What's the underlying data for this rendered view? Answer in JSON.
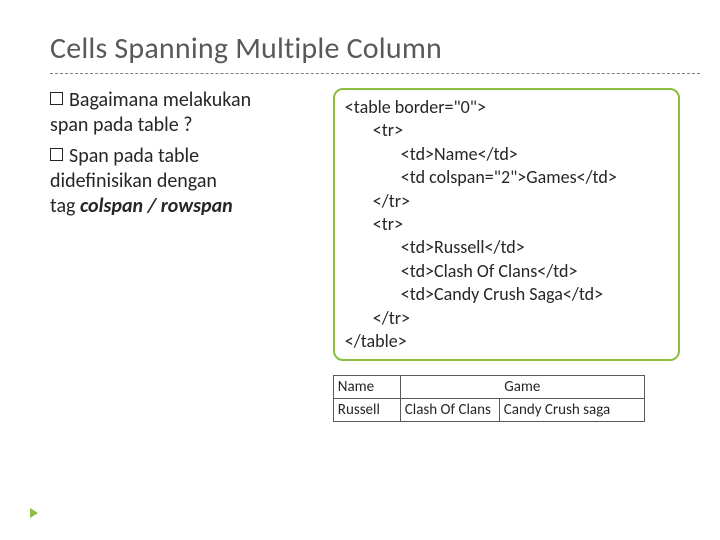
{
  "title": "Cells Spanning Multiple Column",
  "left": {
    "bullet1_first": "Bagaimana melakukan",
    "bullet1_rest": "span pada table ?",
    "bullet2_first": "Span pada table",
    "bullet2_rest1": "didefinisikan dengan",
    "bullet2_rest2_pre": "tag ",
    "bullet2_rest2_em": "colspan / rowspan"
  },
  "code": {
    "l0a": "<table border=\"0\">",
    "l1a": "<tr>",
    "l2a": "<td>Name</td>",
    "l2b": "<td colspan=\"2\">Games</td>",
    "l1b": "</tr>",
    "l1c": "<tr>",
    "l2c": "<td>Russell</td>",
    "l2d": "<td>Clash Of Clans</td>",
    "l2e": "<td>Candy Crush Saga</td>",
    "l1d": "</tr>",
    "l0b": "</table>"
  },
  "result": {
    "h_name": "Name",
    "h_game": "Game",
    "r_name": "Russell",
    "r_g1": "Clash Of Clans",
    "r_g2": "Candy Crush saga"
  }
}
